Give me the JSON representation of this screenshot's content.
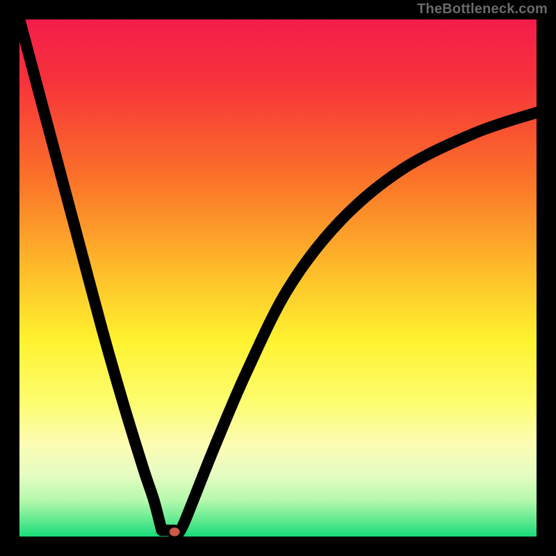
{
  "watermark": {
    "text": "TheBottleneck.com"
  },
  "chart_data": {
    "type": "line",
    "title": "",
    "xlabel": "",
    "ylabel": "",
    "xlim": [
      0,
      100
    ],
    "ylim": [
      0,
      100
    ],
    "gradient_stops": [
      {
        "offset": 0,
        "color": "#f41c4b"
      },
      {
        "offset": 12,
        "color": "#f7333b"
      },
      {
        "offset": 30,
        "color": "#fb6f29"
      },
      {
        "offset": 50,
        "color": "#fec22a"
      },
      {
        "offset": 62,
        "color": "#fef22f"
      },
      {
        "offset": 74,
        "color": "#fdfd6f"
      },
      {
        "offset": 82,
        "color": "#fcfdb2"
      },
      {
        "offset": 88,
        "color": "#e6fcc2"
      },
      {
        "offset": 93,
        "color": "#b6f9ad"
      },
      {
        "offset": 97,
        "color": "#5de98f"
      },
      {
        "offset": 100,
        "color": "#17dc7a"
      }
    ],
    "series": [
      {
        "name": "bottleneck-curve",
        "x": [
          0,
          4,
          8,
          12,
          16,
          20,
          24,
          26,
          28,
          29,
          30,
          31,
          32,
          34,
          38,
          44,
          52,
          62,
          74,
          88,
          100
        ],
        "y": [
          100,
          85,
          70,
          55,
          40,
          26,
          13,
          7,
          3,
          1,
          0,
          1,
          3,
          8,
          18,
          32,
          48,
          61,
          71,
          78,
          82
        ]
      }
    ],
    "marker": {
      "x": 30,
      "y": 0,
      "color": "#cc5a4a"
    },
    "notch": {
      "x_start": 27.5,
      "x_end": 30,
      "y": 1.2
    }
  }
}
